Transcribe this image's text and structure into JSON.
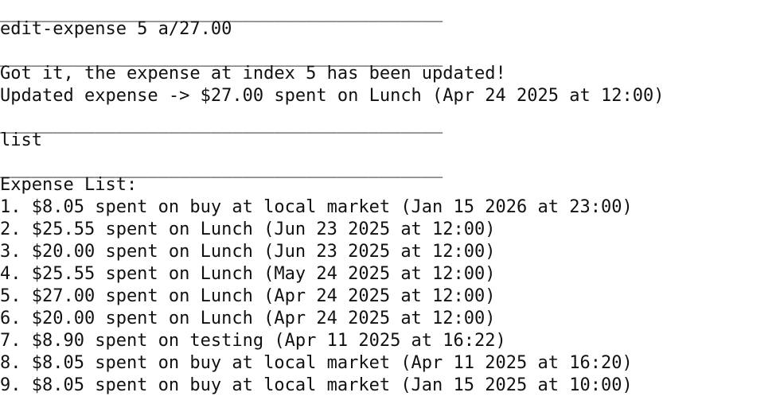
{
  "terminal": {
    "divider": "__________________________________________",
    "command_1": "edit-expense 5 a/27.00",
    "response_1": "Got it, the expense at index 5 has been updated!",
    "response_2": "Updated expense -> $27.00 spent on Lunch (Apr 24 2025 at 12:00)",
    "command_2": "list",
    "list_header": "Expense List:",
    "expenses": [
      "1. $8.05 spent on buy at local market (Jan 15 2026 at 23:00)",
      "2. $25.55 spent on Lunch (Jun 23 2025 at 12:00)",
      "3. $20.00 spent on Lunch (Jun 23 2025 at 12:00)",
      "4. $25.55 spent on Lunch (May 24 2025 at 12:00)",
      "5. $27.00 spent on Lunch (Apr 24 2025 at 12:00)",
      "6. $20.00 spent on Lunch (Apr 24 2025 at 12:00)",
      "7. $8.90 spent on testing (Apr 11 2025 at 16:22)",
      "8. $8.05 spent on buy at local market (Apr 11 2025 at 16:20)",
      "9. $8.05 spent on buy at local market (Jan 15 2025 at 10:00)"
    ]
  }
}
